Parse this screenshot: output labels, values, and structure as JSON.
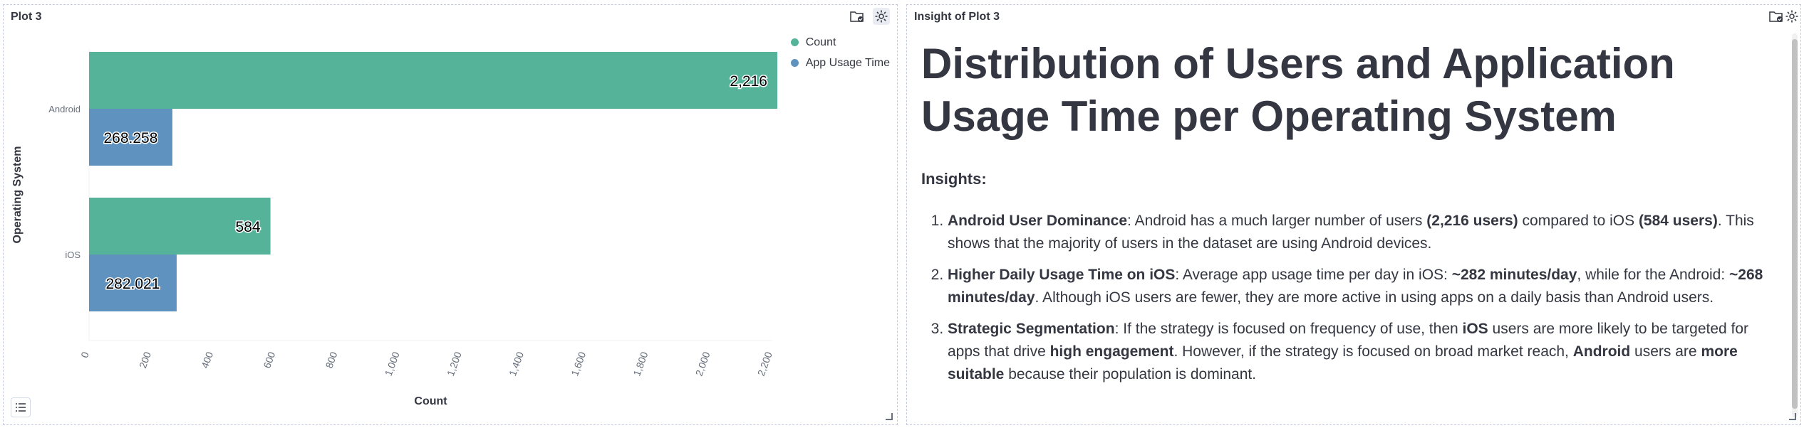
{
  "left_panel": {
    "title": "Plot 3",
    "icons": [
      "folder-check-icon",
      "gear-icon"
    ]
  },
  "right_panel": {
    "title": "Insight of Plot 3",
    "icons": [
      "folder-check-icon",
      "gear-icon"
    ],
    "heading": "Distribution of Users and Application Usage Time per Operating System",
    "insights_label": "Insights:",
    "items": [
      {
        "parts": [
          {
            "b": true,
            "t": "Android User Dominance"
          },
          {
            "b": false,
            "t": ": Android has a much larger number of users "
          },
          {
            "b": true,
            "t": "(2,216 users)"
          },
          {
            "b": false,
            "t": " compared to iOS "
          },
          {
            "b": true,
            "t": "(584 users)"
          },
          {
            "b": false,
            "t": ". This shows that the majority of users in the dataset are using Android devices."
          }
        ]
      },
      {
        "parts": [
          {
            "b": true,
            "t": "Higher Daily Usage Time on iOS"
          },
          {
            "b": false,
            "t": ": Average app usage time per day in iOS: "
          },
          {
            "b": true,
            "t": "~282 minutes/day"
          },
          {
            "b": false,
            "t": ", while for the Android: "
          },
          {
            "b": true,
            "t": "~268 minutes/day"
          },
          {
            "b": false,
            "t": ". Although iOS users are fewer, they are more active in using apps on a daily basis than Android users."
          }
        ]
      },
      {
        "parts": [
          {
            "b": true,
            "t": "Strategic Segmentation"
          },
          {
            "b": false,
            "t": ": If the strategy is focused on frequency of use, then "
          },
          {
            "b": true,
            "t": "iOS"
          },
          {
            "b": false,
            "t": " users are more likely to be targeted for apps that drive "
          },
          {
            "b": true,
            "t": "high engagement"
          },
          {
            "b": false,
            "t": ". However, if the strategy is focused on broad market reach, "
          },
          {
            "b": true,
            "t": "Android"
          },
          {
            "b": false,
            "t": " users are "
          },
          {
            "b": true,
            "t": "more suitable"
          },
          {
            "b": false,
            "t": " because their population is dominant."
          }
        ]
      }
    ]
  },
  "chart_data": {
    "type": "bar",
    "orientation": "horizontal",
    "categories": [
      "Android",
      "iOS"
    ],
    "series": [
      {
        "name": "Count",
        "values": [
          2216,
          584
        ],
        "labels": [
          "2,216",
          "584"
        ],
        "color": "#54b399"
      },
      {
        "name": "App Usage Time",
        "values": [
          268.258,
          282.021
        ],
        "labels": [
          "268.258",
          "282.021"
        ],
        "color": "#6092c0"
      }
    ],
    "xlabel": "Count",
    "ylabel": "Operating System",
    "xlim": [
      0,
      2200
    ],
    "xticks": [
      "0",
      "200",
      "400",
      "600",
      "800",
      "1,000",
      "1,200",
      "1,400",
      "1,600",
      "1,800",
      "2,000",
      "2,200"
    ],
    "legend_position": "top-right"
  }
}
